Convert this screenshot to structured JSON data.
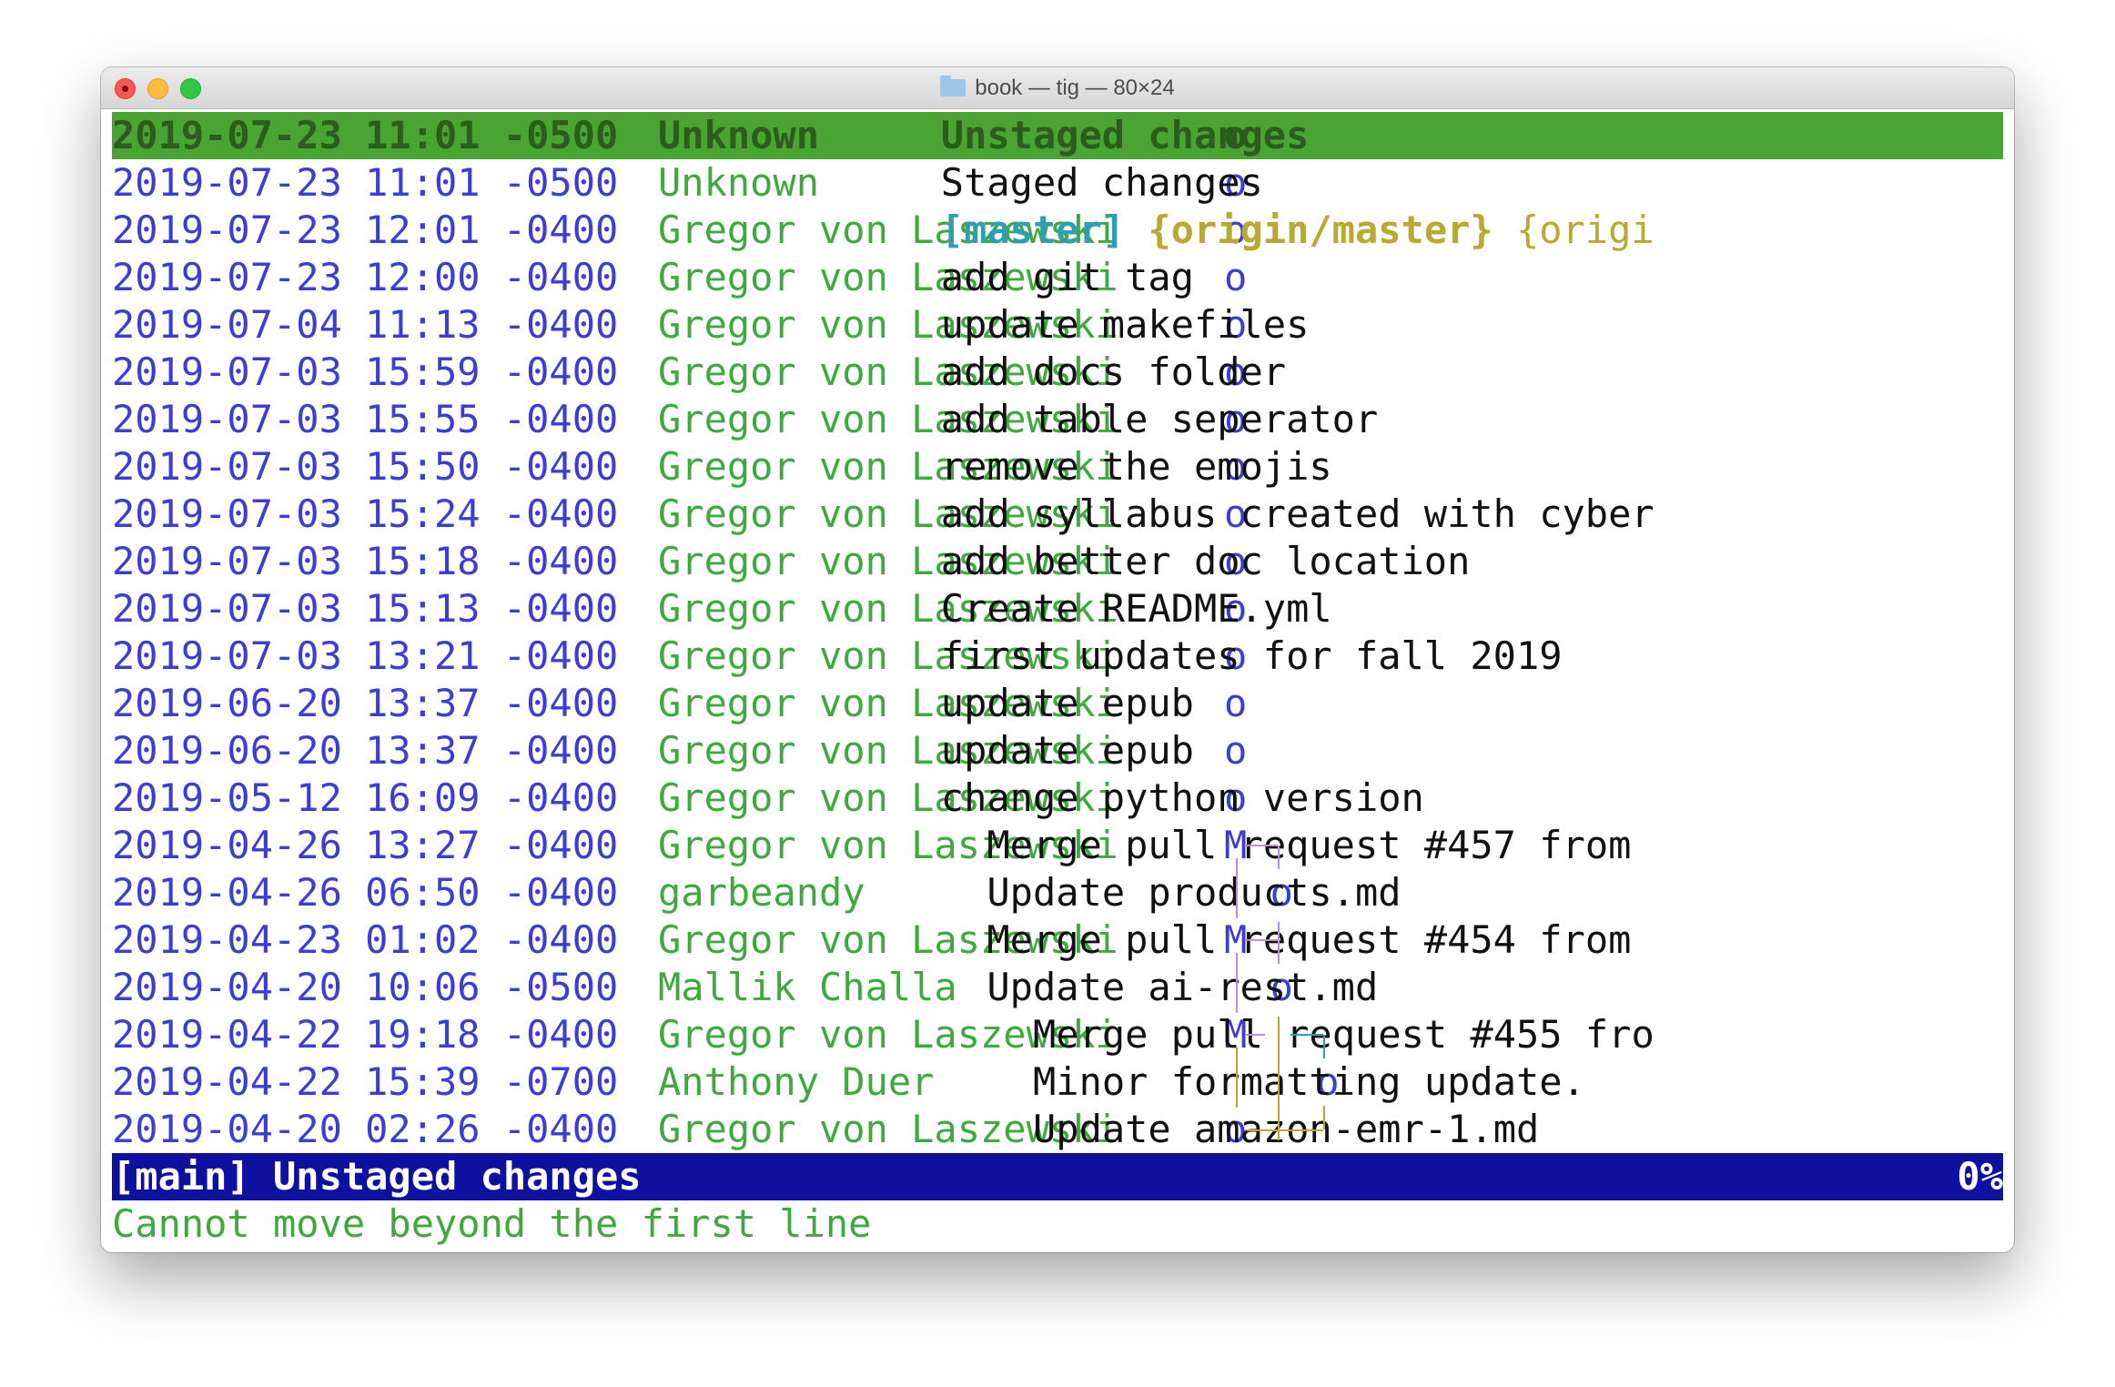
{
  "window": {
    "title": "book — tig — 80×24"
  },
  "rows": [
    {
      "date": "2019-07-23 11:01 -0500",
      "author": "Unknown",
      "graph": "o",
      "message": "Unstaged changes",
      "selected": true
    },
    {
      "date": "2019-07-23 11:01 -0500",
      "author": "Unknown",
      "graph": "o",
      "message": "Staged changes"
    },
    {
      "date": "2019-07-23 12:01 -0400",
      "author": "Gregor von Laszewski",
      "graph": "o",
      "refs": {
        "local": "[master]",
        "remote": "{origin/master}",
        "other": "{origi"
      }
    },
    {
      "date": "2019-07-23 12:00 -0400",
      "author": "Gregor von Laszewski",
      "graph": "o",
      "message": "add git tag"
    },
    {
      "date": "2019-07-04 11:13 -0400",
      "author": "Gregor von Laszewski",
      "graph": "o",
      "message": "update makefiles"
    },
    {
      "date": "2019-07-03 15:59 -0400",
      "author": "Gregor von Laszewski",
      "graph": "o",
      "message": "add docs folder"
    },
    {
      "date": "2019-07-03 15:55 -0400",
      "author": "Gregor von Laszewski",
      "graph": "o",
      "message": "add table seperator"
    },
    {
      "date": "2019-07-03 15:50 -0400",
      "author": "Gregor von Laszewski",
      "graph": "o",
      "message": "remove the emojis"
    },
    {
      "date": "2019-07-03 15:24 -0400",
      "author": "Gregor von Laszewski",
      "graph": "o",
      "message": "add syllabus created with cyber"
    },
    {
      "date": "2019-07-03 15:18 -0400",
      "author": "Gregor von Laszewski",
      "graph": "o",
      "message": "add better doc location"
    },
    {
      "date": "2019-07-03 15:13 -0400",
      "author": "Gregor von Laszewski",
      "graph": "o",
      "message": "Create README.yml"
    },
    {
      "date": "2019-07-03 13:21 -0400",
      "author": "Gregor von Laszewski",
      "graph": "o",
      "message": "first updates for fall 2019"
    },
    {
      "date": "2019-06-20 13:37 -0400",
      "author": "Gregor von Laszewski",
      "graph": "o",
      "message": "update epub"
    },
    {
      "date": "2019-06-20 13:37 -0400",
      "author": "Gregor von Laszewski",
      "graph": "o",
      "message": "update epub"
    },
    {
      "date": "2019-05-12 16:09 -0400",
      "author": "Gregor von Laszewski",
      "graph": "o",
      "message": "change python version"
    },
    {
      "date": "2019-04-26 13:27 -0400",
      "author": "Gregor von Laszewski",
      "graph": "M",
      "message": "Merge pull request #457 from"
    },
    {
      "date": "2019-04-26 06:50 -0400",
      "author": "garbeandy",
      "graph": "o",
      "message": "Update products.md"
    },
    {
      "date": "2019-04-23 01:02 -0400",
      "author": "Gregor von Laszewski",
      "graph": "M",
      "message": "Merge pull request #454 from"
    },
    {
      "date": "2019-04-20 10:06 -0500",
      "author": "Mallik Challa",
      "graph": "o",
      "message": "Update ai-rest.md"
    },
    {
      "date": "2019-04-22 19:18 -0400",
      "author": "Gregor von Laszewski",
      "graph": "M",
      "message": "Merge pull request #455 fro"
    },
    {
      "date": "2019-04-22 15:39 -0700",
      "author": "Anthony Duer",
      "graph": "o",
      "message": "Minor formatting update."
    },
    {
      "date": "2019-04-20 02:26 -0400",
      "author": "Gregor von Laszewski",
      "graph": "o",
      "message": "Update amazon-emr-1.md"
    }
  ],
  "status": {
    "view": "[main] Unstaged changes",
    "percent": "0%"
  },
  "message": "Cannot move beyond the first line",
  "colors": {
    "date": "#3d3dd6",
    "author": "#3fa93f",
    "selected_bg": "#4aa431",
    "status_bg": "#0e10a0",
    "ref_local": "#2f9fb0",
    "ref_remote": "#b6aa31",
    "graph_line_main": "#b98fd6",
    "graph_line_side": "#b6aa31",
    "graph_line_cyan": "#2f9fb0"
  }
}
